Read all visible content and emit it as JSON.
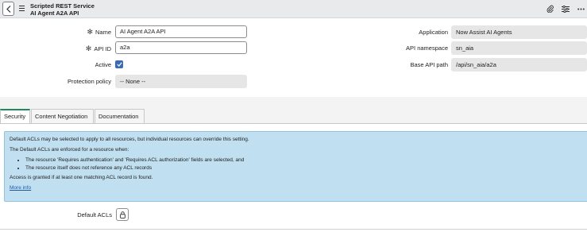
{
  "header": {
    "record_type": "Scripted REST Service",
    "record_name": "AI Agent A2A API"
  },
  "form": {
    "name_label": "Name",
    "name_value": "AI Agent A2A API",
    "api_id_label": "API ID",
    "api_id_value": "a2a",
    "active_label": "Active",
    "active_checked": true,
    "protection_label": "Protection policy",
    "protection_value": "-- None --",
    "application_label": "Application",
    "application_value": "Now Assist AI Agents",
    "namespace_label": "API namespace",
    "namespace_value": "sn_aia",
    "base_path_label": "Base API path",
    "base_path_value": "/api/sn_aia/a2a"
  },
  "tabs": [
    {
      "label": "Security",
      "active": true
    },
    {
      "label": "Content Negotiation",
      "active": false
    },
    {
      "label": "Documentation",
      "active": false
    }
  ],
  "security": {
    "info_line1": "Default ACLs may be selected to apply to all resources, but individual resources can override this setting.",
    "info_line2": "The Default ACLs are enforced for a resource when:",
    "bullets": [
      "The resource 'Requires authentication' and 'Requires ACL authorization' fields are selected, and",
      "The resource itself does not reference any ACL records"
    ],
    "info_line3": "Access is granted if at least one matching ACL record is found.",
    "more_info": "More info",
    "default_acls_label": "Default ACLs"
  },
  "colors": {
    "accent": "#3a6bb3",
    "tab_active": "#1e8a5d",
    "info_bg": "#c0dff0"
  },
  "icons": [
    "back-icon",
    "menu-icon",
    "attachment-icon",
    "settings-sliders-icon",
    "more-icon",
    "asterisk-icon",
    "checkmark-icon",
    "lock-icon"
  ]
}
